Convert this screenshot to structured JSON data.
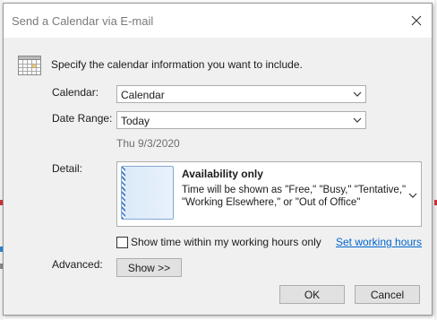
{
  "dialog": {
    "title": "Send a Calendar via E-mail",
    "close_icon": "close-icon",
    "header_icon": "calendar-grid-icon",
    "instruction": "Specify the calendar information you want to include."
  },
  "form": {
    "calendar_label": "Calendar:",
    "calendar_value": "Calendar",
    "date_range_label": "Date Range:",
    "date_range_value": "Today",
    "date_text": "Thu 9/3/2020",
    "detail_label": "Detail:",
    "detail_title": "Availability only",
    "detail_desc": "Time will be shown as \"Free,\" \"Busy,\" \"Tentative,\" \"Working Elsewhere,\" or \"Out of Office\"",
    "working_hours_label": "Show time within my working hours only",
    "working_hours_checked": false,
    "set_working_hours_link": "Set working hours",
    "advanced_label": "Advanced:",
    "show_button": "Show >>"
  },
  "buttons": {
    "ok": "OK",
    "cancel": "Cancel"
  },
  "colors": {
    "dialog_bg": "#f0f0f0",
    "link": "#0066cc",
    "accent_blue": "#4a86c8"
  }
}
